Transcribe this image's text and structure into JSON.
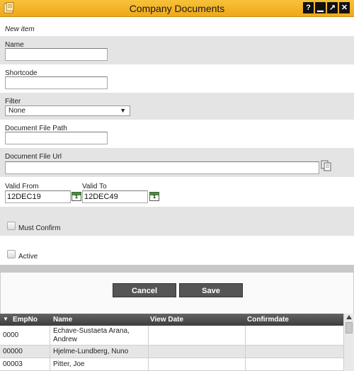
{
  "window": {
    "title": "Company Documents",
    "buttons": [
      "help",
      "minimize",
      "maximize",
      "close"
    ]
  },
  "form": {
    "mode": "New item",
    "name_label": "Name",
    "name_value": "",
    "shortcode_label": "Shortcode",
    "shortcode_value": "",
    "filter_label": "Filter",
    "filter_value": "None",
    "doc_path_label": "Document File Path",
    "doc_path_value": "",
    "doc_url_label": "Document File Url",
    "doc_url_value": "",
    "valid_from_label": "Valid From",
    "valid_from_value": "12DEC19",
    "valid_to_label": "Valid To",
    "valid_to_value": "12DEC49",
    "calendar_day": "1",
    "must_confirm_label": "Must Confirm",
    "must_confirm_checked": false,
    "active_label": "Active",
    "active_checked": false
  },
  "actions": {
    "cancel_label": "Cancel",
    "save_label": "Save"
  },
  "grid": {
    "columns": [
      "EmpNo",
      "Name",
      "View Date",
      "Confirmdate"
    ],
    "rows": [
      {
        "empno": "0000",
        "name": "Echave-Sustaeta Arana, Andrew",
        "view_date": "",
        "confirmdate": ""
      },
      {
        "empno": "00000",
        "name": "Hjelme-Lundberg, Nuno",
        "view_date": "",
        "confirmdate": ""
      },
      {
        "empno": "00003",
        "name": "Pitter, Joe",
        "view_date": "",
        "confirmdate": ""
      }
    ]
  },
  "colors": {
    "titlebar": "#f0a818",
    "band_gray": "#e4e4e4",
    "button_bg": "#555555",
    "grid_header": "#4a4a4a"
  },
  "icons": {
    "app": "document-app-icon",
    "calendar": "calendar-icon",
    "copy": "copy-icon"
  }
}
